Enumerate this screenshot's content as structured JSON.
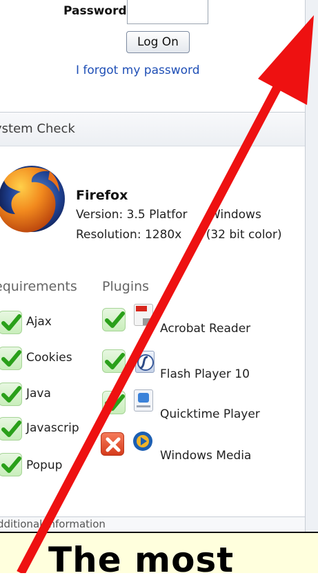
{
  "login": {
    "password_label": "Password",
    "password_value": "",
    "logon_button": "Log On",
    "forgot_link": "I forgot my password"
  },
  "system_check": {
    "title": "ystem Check",
    "browser": {
      "name": "Firefox",
      "version_line": "Version: 3.5  Platfor",
      "version_line_tail": " Windows",
      "resolution_line": "Resolution: 1280x",
      "resolution_line_tail": " (32 bit color)"
    },
    "requirements_heading": "equirements",
    "plugins_heading": "Plugins",
    "requirements": [
      {
        "label": "Ajax",
        "status": "ok"
      },
      {
        "label": "Cookies",
        "status": "ok"
      },
      {
        "label": "Java",
        "status": "ok"
      },
      {
        "label": "Javascrip",
        "status": "ok"
      },
      {
        "label": "Popup",
        "status": "ok"
      }
    ],
    "plugins": [
      {
        "label": "Acrobat Reader",
        "status": "ok",
        "icon": "pdf-icon"
      },
      {
        "label": "Flash Player 10",
        "status": "ok",
        "icon": "flash-icon"
      },
      {
        "label": "Quicktime Player",
        "status": "ok",
        "icon": "quicktime-icon"
      },
      {
        "label": "Windows Media",
        "status": "fail",
        "icon": "windows-media-icon"
      }
    ],
    "footer_partial": "dditional Information"
  },
  "caption": {
    "text": "The most"
  },
  "colors": {
    "arrow": "#ee1111",
    "link": "#1f4fb6",
    "caption_bg": "#ffffdd",
    "check_bg": "#c9eebb",
    "cross_bg": "#d63c1c"
  }
}
